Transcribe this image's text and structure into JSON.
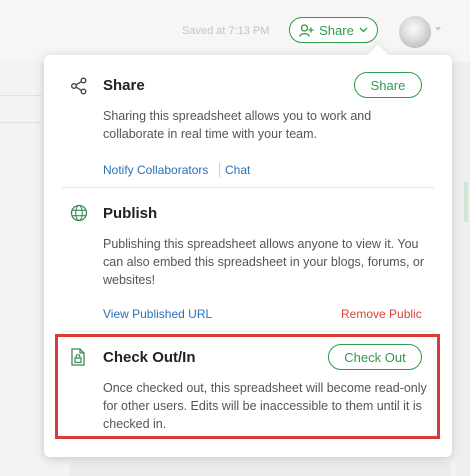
{
  "toolbar": {
    "saved_text": "Saved at 7:13 PM",
    "share_label": "Share",
    "share_icon": "add-user-icon",
    "dropdown_icon": "chevron-down-icon"
  },
  "share": {
    "icon": "share-icon",
    "title": "Share",
    "button_label": "Share",
    "description": "Sharing this spreadsheet allows you to work and collaborate in real time with your team.",
    "links": [
      "Notify Collaborators",
      "Chat"
    ]
  },
  "publish": {
    "icon": "globe-icon",
    "title": "Publish",
    "description": "Publishing this spreadsheet allows anyone to view it. You can also embed this spreadsheet in your blogs, forums, or websites!",
    "link_view": "View Published URL",
    "link_remove": "Remove Public"
  },
  "checkout": {
    "icon": "locked-document-icon",
    "title": "Check Out/In",
    "button_label": "Check Out",
    "description": "Once checked out, this spreadsheet will become read-only for other users. Edits will be inaccessible to them until it is checked in."
  },
  "colors": {
    "accent_green": "#2f9a4c",
    "link_blue": "#2873b9",
    "danger_red": "#d9453a",
    "highlight_red": "#d93a3a"
  }
}
